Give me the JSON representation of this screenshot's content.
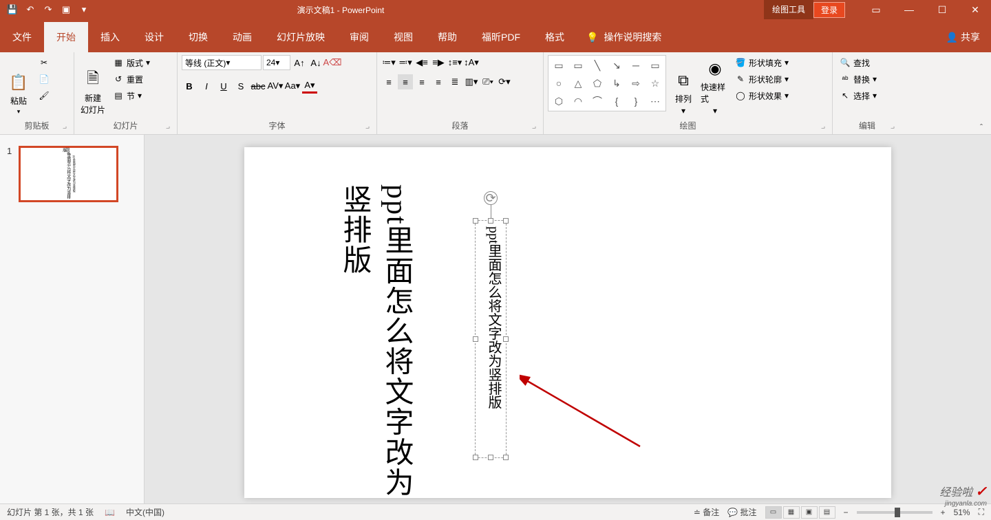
{
  "title": {
    "doc": "演示文稿1 - PowerPoint",
    "tool": "绘图工具"
  },
  "win": {
    "login": "登录"
  },
  "tabs": {
    "file": "文件",
    "home": "开始",
    "insert": "插入",
    "design": "设计",
    "transition": "切换",
    "animation": "动画",
    "slideshow": "幻灯片放映",
    "review": "审阅",
    "view": "视图",
    "help": "帮助",
    "foxit": "福昕PDF",
    "format": "格式",
    "tellme": "操作说明搜索",
    "share": "共享"
  },
  "ribbon": {
    "clipboard": {
      "label": "剪贴板",
      "paste": "粘贴"
    },
    "slides": {
      "label": "幻灯片",
      "new": "新建\n幻灯片",
      "layout": "版式",
      "reset": "重置",
      "section": "节"
    },
    "font": {
      "label": "字体",
      "family": "等线 (正文)",
      "size": "24"
    },
    "paragraph": {
      "label": "段落"
    },
    "drawing": {
      "label": "绘图",
      "arrange": "排列",
      "quickstyles": "快速样式",
      "fill": "形状填充",
      "outline": "形状轮廓",
      "effects": "形状效果"
    },
    "editing": {
      "label": "编辑",
      "find": "查找",
      "replace": "替换",
      "select": "选择"
    }
  },
  "slide": {
    "big_text": "ppt里面怎么将文字改为竖排版",
    "small_text": "ppt里面怎么将文字改为竖排版"
  },
  "thumb": {
    "num": "1"
  },
  "status": {
    "slideinfo": "幻灯片 第 1 张，共 1 张",
    "lang": "中文(中国)",
    "notes": "备注",
    "comments": "批注",
    "zoom": "51%"
  },
  "watermark": {
    "main": "经验啦",
    "sub": "jingyanla.com"
  }
}
